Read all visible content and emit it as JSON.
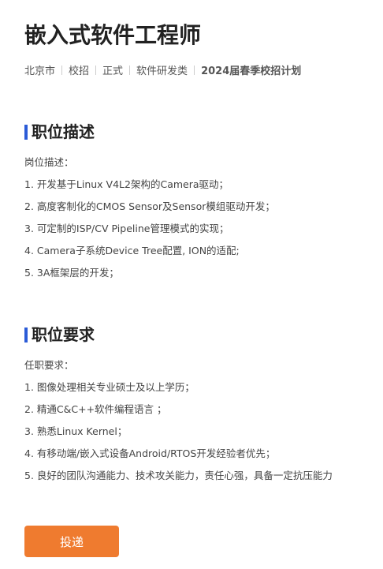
{
  "job": {
    "title": "嵌入式软件工程师",
    "meta": [
      "北京市",
      "校招",
      "正式",
      "软件研发类",
      "2024届春季校招计划"
    ]
  },
  "description": {
    "heading": "职位描述",
    "lines": [
      "岗位描述：",
      "1. 开发基于Linux V4L2架构的Camera驱动；",
      "2. 高度客制化的CMOS Sensor及Sensor模组驱动开发；",
      "3. 可定制的ISP/CV Pipeline管理模式的实现；",
      "4. Camera子系统Device Tree配置, ION的适配;",
      "5. 3A框架层的开发；"
    ]
  },
  "requirements": {
    "heading": "职位要求",
    "lines": [
      "任职要求：",
      "1. 图像处理相关专业硕士及以上学历；",
      "2. 精通C&C++软件编程语言 ；",
      "3. 熟悉Linux Kernel；",
      "4. 有移动端/嵌入式设备Android/RTOS开发经验者优先；",
      "5. 良好的团队沟通能力、技术攻关能力，责任心强，具备一定抗压能力"
    ]
  },
  "actions": {
    "apply_label": "投递"
  },
  "colors": {
    "accent_bar": "#2b5bd7",
    "apply_button": "#ef7b2f"
  }
}
